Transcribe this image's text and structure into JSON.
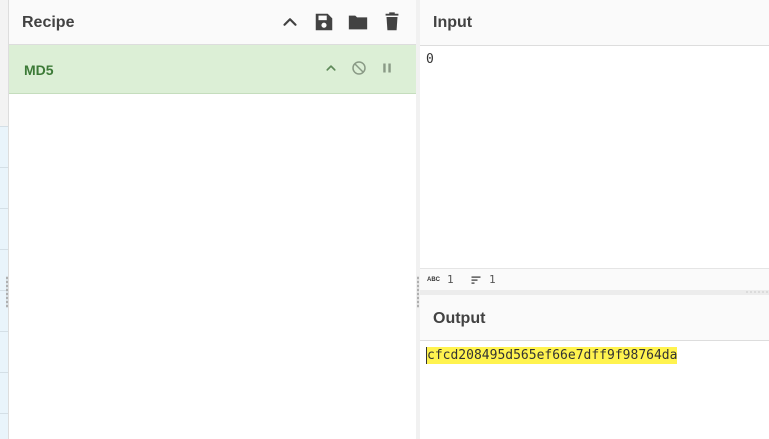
{
  "recipe": {
    "title": "Recipe",
    "operation": {
      "name": "MD5"
    }
  },
  "input": {
    "title": "Input",
    "value": "0",
    "status": {
      "length_label": "ABC",
      "length": "1",
      "lines": "1"
    }
  },
  "output": {
    "title": "Output",
    "value": "cfcd208495d565ef66e7dff9f98764da"
  },
  "colors": {
    "operation_bg": "#dcefd6",
    "operation_text": "#3c7a37",
    "highlight": "#fff34f"
  },
  "icons": {
    "collapse": "chevron-up-icon",
    "save": "save-icon",
    "load": "folder-icon",
    "clear": "trash-icon",
    "disable": "disable-icon",
    "breakpoint": "pause-icon",
    "lines": "sort-lines-icon"
  }
}
